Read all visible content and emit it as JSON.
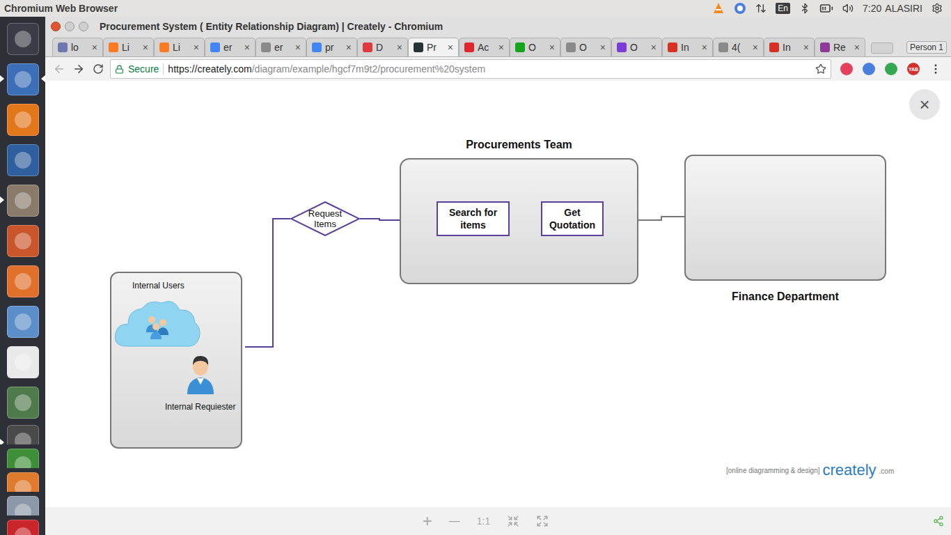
{
  "top_panel": {
    "app_name": "Chromium Web Browser",
    "keyboard": "En",
    "clock": "7:20",
    "user": "ALASIRI"
  },
  "launcher": [
    {
      "color": "#3a3c46",
      "kind": "full",
      "running": false,
      "focused": false
    },
    {
      "color": "#3d6fb8",
      "kind": "full",
      "running": true,
      "focused": true
    },
    {
      "color": "#e2761b",
      "kind": "full",
      "running": false,
      "focused": false
    },
    {
      "color": "#2f5f9e",
      "kind": "full",
      "running": false,
      "focused": false
    },
    {
      "color": "#8a7a6a",
      "kind": "full",
      "running": true,
      "focused": false
    },
    {
      "color": "#c9562a",
      "kind": "full",
      "running": false,
      "focused": false
    },
    {
      "color": "#e0702c",
      "kind": "full",
      "running": false,
      "focused": false
    },
    {
      "color": "#5c8fc9",
      "kind": "full",
      "running": false,
      "focused": false
    },
    {
      "color": "#e9e9e9",
      "kind": "full",
      "running": false,
      "focused": false
    },
    {
      "color": "#4f7a4c",
      "kind": "full",
      "running": false,
      "focused": false
    },
    {
      "color": "#4a4a4a",
      "kind": "stacked",
      "running": true,
      "focused": false
    },
    {
      "color": "#3f8f3a",
      "kind": "stacked",
      "running": false,
      "focused": false
    },
    {
      "color": "#e07a2c",
      "kind": "stacked",
      "running": false,
      "focused": false
    },
    {
      "color": "#8c98a8",
      "kind": "stacked",
      "running": false,
      "focused": false
    },
    {
      "color": "#c8262a",
      "kind": "stacked",
      "running": false,
      "focused": false
    }
  ],
  "window": {
    "title": "Procurement System ( Entity Relationship Diagram) | Creately - Chromium"
  },
  "tab_close_glyph": "×",
  "tabs": [
    {
      "label": "lo",
      "selected": false,
      "color": "#6c78af"
    },
    {
      "label": "Li",
      "selected": false,
      "color": "#fb7a24"
    },
    {
      "label": "Li",
      "selected": false,
      "color": "#fb7a24"
    },
    {
      "label": "er",
      "selected": false,
      "color": "#4285f4"
    },
    {
      "label": "er",
      "selected": false,
      "color": "#8a8a8a"
    },
    {
      "label": "pr",
      "selected": false,
      "color": "#4285f4"
    },
    {
      "label": "D",
      "selected": false,
      "color": "#e0393e"
    },
    {
      "label": "Pr",
      "selected": true,
      "color": "#263238"
    },
    {
      "label": "Ac",
      "selected": false,
      "color": "#e0252b"
    },
    {
      "label": "O",
      "selected": false,
      "color": "#14a31a"
    },
    {
      "label": "O",
      "selected": false,
      "color": "#8a8a8a"
    },
    {
      "label": "O",
      "selected": false,
      "color": "#7d3bd6"
    },
    {
      "label": "In",
      "selected": false,
      "color": "#d93025"
    },
    {
      "label": "4(",
      "selected": false,
      "color": "#8a8a8a"
    },
    {
      "label": "In",
      "selected": false,
      "color": "#d93025"
    },
    {
      "label": "Re",
      "selected": false,
      "color": "#8e3a99"
    }
  ],
  "profile": {
    "label": "Person 1"
  },
  "address_bar": {
    "secure_label": "Secure",
    "url_host": "https://creately.com",
    "url_path": "/diagram/example/hgcf7m9t2/procurement%20system"
  },
  "extensions": [
    {
      "color": "#e5405e"
    },
    {
      "color": "#4a7fe0"
    },
    {
      "color": "#34a853"
    },
    {
      "color": "#d32f2f",
      "label": "YAB"
    }
  ],
  "close_button": "×",
  "diagram": {
    "procurement_team": {
      "label": "Procurements Team",
      "steps": [
        "Search for items",
        "Get Quotation"
      ]
    },
    "finance": {
      "label": "Finance Department"
    },
    "relationship": {
      "label": "Request Items"
    },
    "internal_users": {
      "label": "Internal Users",
      "member": "Internal Requiester"
    }
  },
  "watermark": {
    "tagline": "[online diagramming & design]",
    "brand": "creately",
    "suffix": ".com"
  },
  "zoom_bar": {
    "zoom_in": "+",
    "zoom_out": "—",
    "actual_size": "1:1"
  }
}
